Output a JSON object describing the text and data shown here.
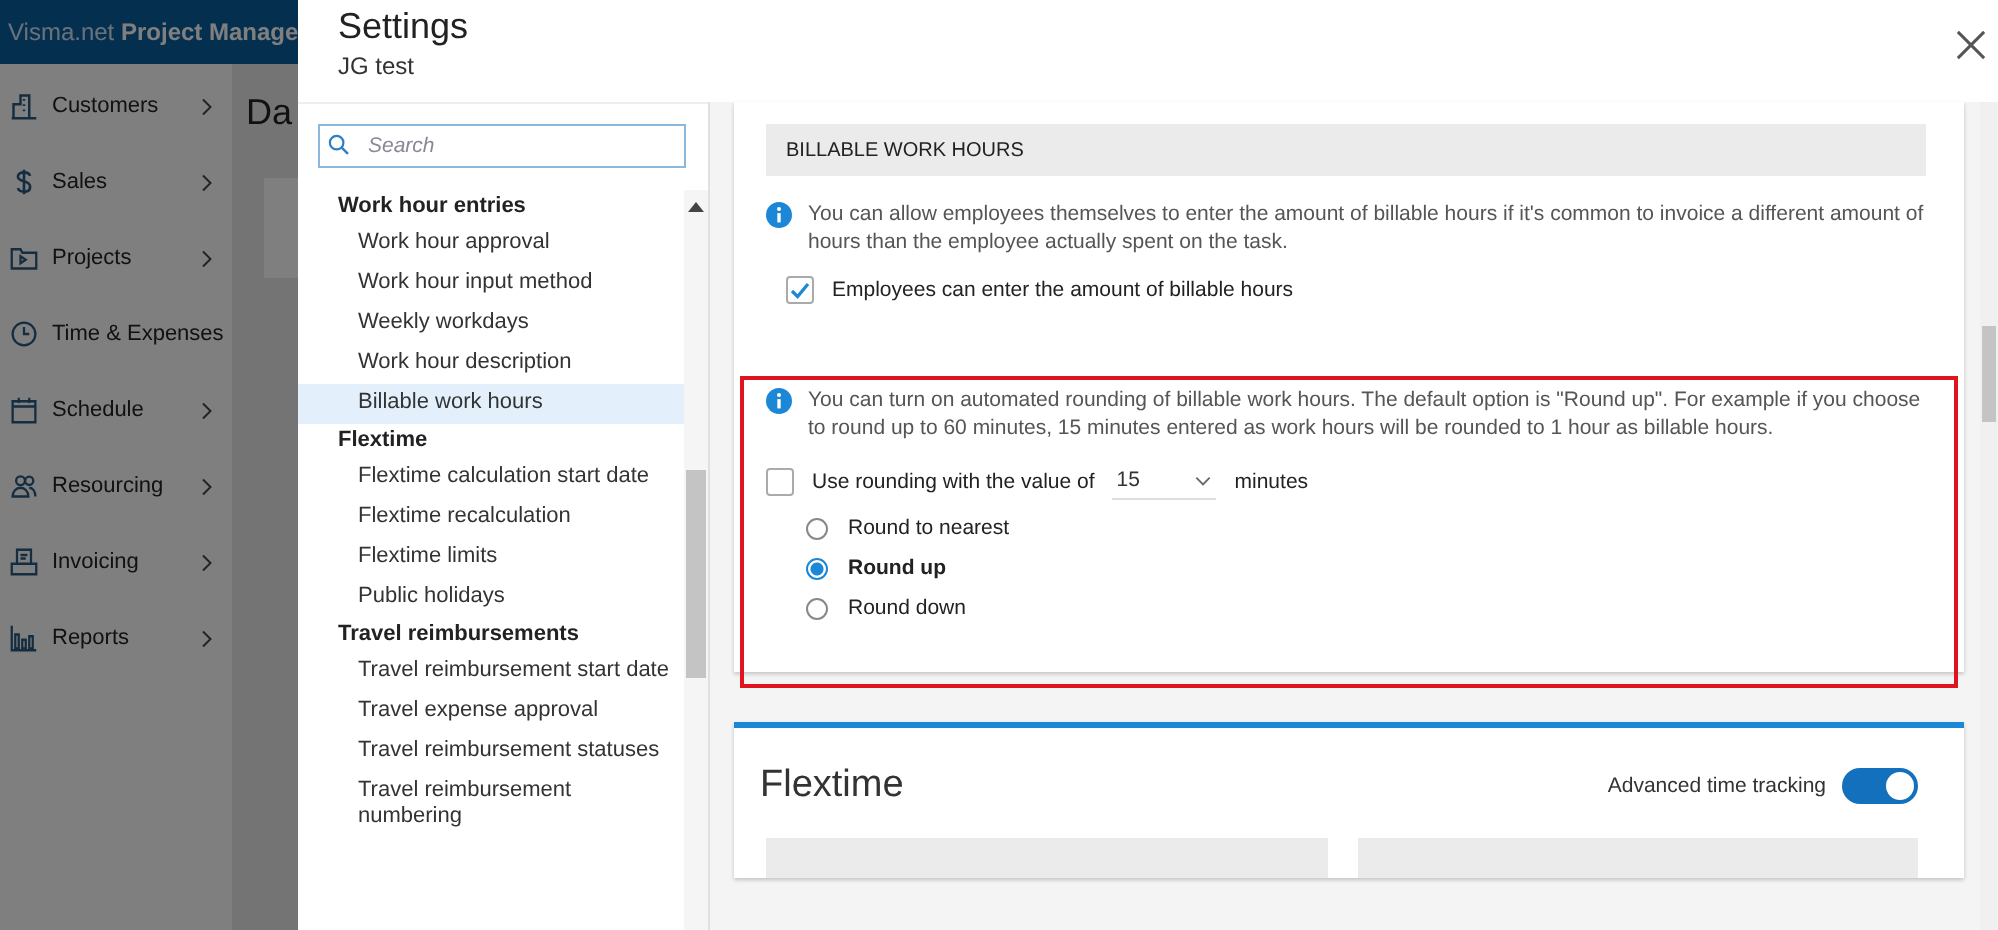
{
  "background_app": {
    "brand": "Visma.net",
    "product": "Project Manage",
    "page_title": "Da",
    "nav": [
      {
        "label": "Customers"
      },
      {
        "label": "Sales"
      },
      {
        "label": "Projects"
      },
      {
        "label": "Time & Expenses"
      },
      {
        "label": "Schedule"
      },
      {
        "label": "Resourcing"
      },
      {
        "label": "Invoicing"
      },
      {
        "label": "Reports"
      }
    ]
  },
  "settings": {
    "title": "Settings",
    "subtitle": "JG test",
    "search": {
      "placeholder": "Search"
    },
    "nav": [
      {
        "label": "Work hour entries",
        "children": [
          {
            "label": "Work hour approval",
            "selected": false
          },
          {
            "label": "Work hour input method",
            "selected": false
          },
          {
            "label": "Weekly workdays",
            "selected": false
          },
          {
            "label": "Work hour description",
            "selected": false
          },
          {
            "label": "Billable work hours",
            "selected": true
          }
        ]
      },
      {
        "label": "Flextime",
        "children": [
          {
            "label": "Flextime calculation start date",
            "selected": false
          },
          {
            "label": "Flextime recalculation",
            "selected": false
          },
          {
            "label": "Flextime limits",
            "selected": false
          },
          {
            "label": "Public holidays",
            "selected": false
          }
        ]
      },
      {
        "label": "Travel reimbursements",
        "children": [
          {
            "label": "Travel reimbursement start date",
            "selected": false
          },
          {
            "label": "Travel expense approval",
            "selected": false
          },
          {
            "label": "Travel reimbursement statuses",
            "selected": false
          },
          {
            "label": "Travel reimbursement numbering",
            "selected": false
          }
        ]
      }
    ]
  },
  "content": {
    "section_title": "BILLABLE WORK HOURS",
    "info": "You can allow employees themselves to enter the amount of billable hours if it's common to invoice a different amount of hours than the employee actually spent on the task.",
    "billable_option": {
      "label": "Employees can enter the amount of billable hours",
      "checked": true
    },
    "rounding_info": "You can turn on automated rounding of billable work hours. The default option is \"Round up\". For example if you choose to round up to 60 minutes, 15 minutes entered as work hours will be rounded to 1 hour as billable hours.",
    "rounding": {
      "label_before": "Use rounding with the value of",
      "value": "15",
      "label_after": "minutes",
      "checked": false,
      "options": [
        {
          "label": "Round to nearest",
          "selected": false
        },
        {
          "label": "Round up",
          "selected": true
        },
        {
          "label": "Round down",
          "selected": false
        }
      ]
    },
    "flextime": {
      "title": "Flextime",
      "toggle": {
        "label": "Advanced time tracking",
        "on": true
      }
    }
  }
}
